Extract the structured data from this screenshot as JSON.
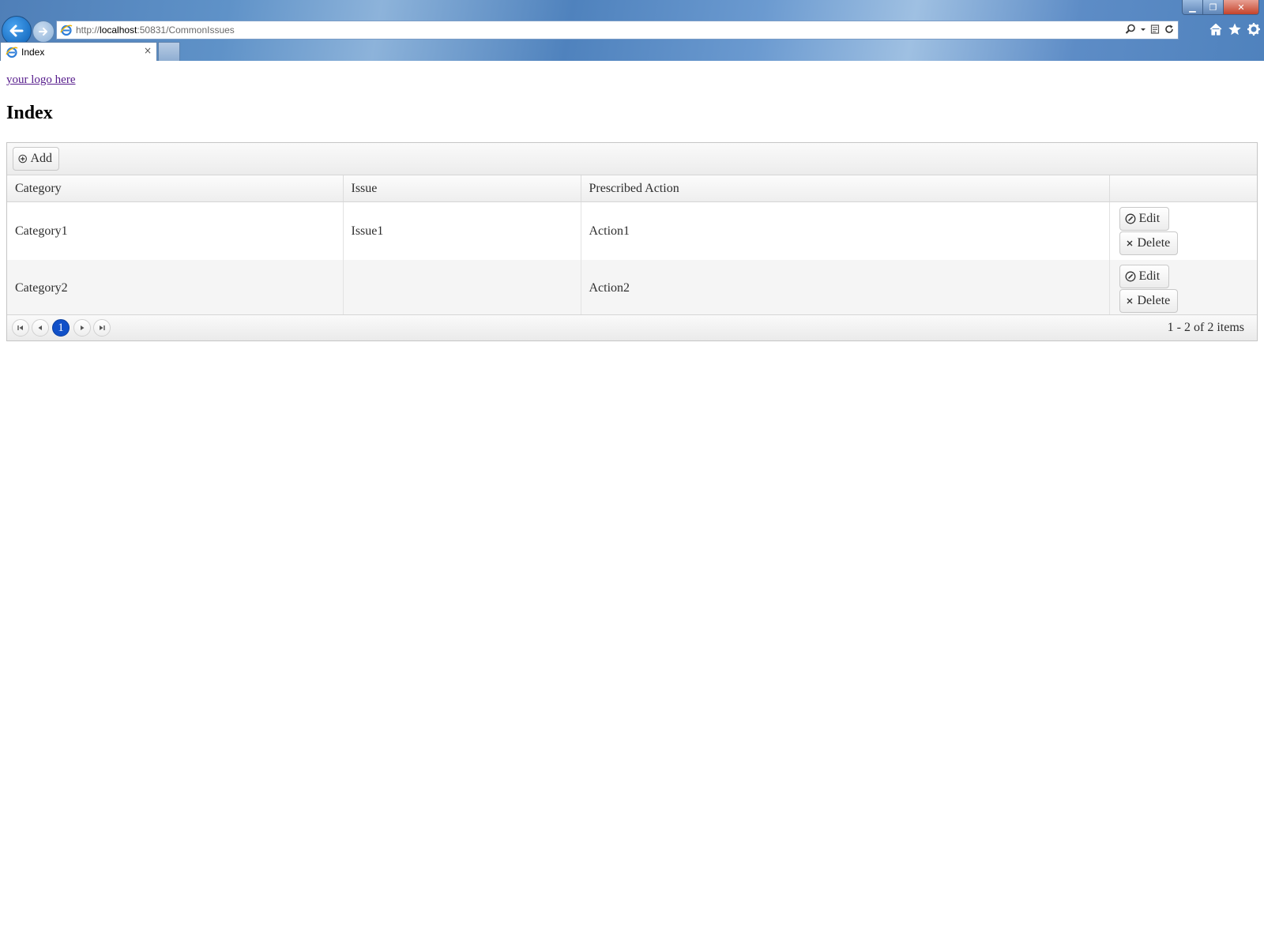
{
  "browser": {
    "url_prefix": "http://",
    "url_host": "localhost",
    "url_rest": ":50831/CommonIssues",
    "tab_title": "Index",
    "tab_close": "×",
    "window_controls": {
      "minimize": "▁",
      "restore": "❐",
      "close": "✕"
    },
    "accent": "#4f82bd"
  },
  "page": {
    "logo_text": "your logo here",
    "title": "Index"
  },
  "grid": {
    "toolbar": {
      "add_label": "Add"
    },
    "columns": [
      "Category",
      "Issue",
      "Prescribed Action",
      ""
    ],
    "rows": [
      {
        "category": "Category1",
        "issue": "Issue1",
        "action": "Action1",
        "edit_label": "Edit",
        "delete_label": "Delete"
      },
      {
        "category": "Category2",
        "issue": "",
        "action": "Action2",
        "edit_label": "Edit",
        "delete_label": "Delete"
      }
    ],
    "pager": {
      "current_page": "1",
      "info": "1 - 2 of 2 items",
      "current_color": "#1050c8"
    }
  }
}
